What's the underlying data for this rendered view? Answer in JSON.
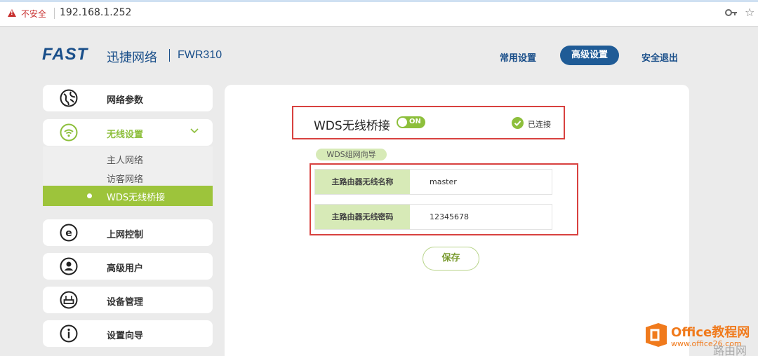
{
  "browser": {
    "security_label": "不安全",
    "url": "192.168.1.252"
  },
  "header": {
    "logo": "FAST",
    "brand": "迅捷网络",
    "model": "FWR310",
    "nav": {
      "common": "常用设置",
      "advanced": "高级设置",
      "logout": "安全退出"
    }
  },
  "sidebar": {
    "items": [
      {
        "label": "网络参数",
        "icon": "globe-icon"
      },
      {
        "label": "无线设置",
        "icon": "wifi-icon"
      },
      {
        "label": "上网控制",
        "icon": "internet-icon"
      },
      {
        "label": "高级用户",
        "icon": "user-icon"
      },
      {
        "label": "设备管理",
        "icon": "router-icon"
      },
      {
        "label": "设置向导",
        "icon": "info-icon"
      }
    ],
    "wireless_sub": {
      "host": "主人网络",
      "guest": "访客网络",
      "wds": "WDS无线桥接"
    }
  },
  "main": {
    "wds_title": "WDS无线桥接",
    "toggle_label": "ON",
    "toggle_on": true,
    "status": "已连接",
    "guide_tag": "WDS组网向导",
    "fields": [
      {
        "label": "主路由器无线名称",
        "value": "master"
      },
      {
        "label": "主路由器无线密码",
        "value": "12345678"
      }
    ],
    "save_label": "保存"
  },
  "watermark": {
    "title": "Office教程网",
    "url": "www.office26.com",
    "site": "路由网"
  },
  "colors": {
    "brand_blue": "#1f5b96",
    "accent_green": "#8dbf3c",
    "highlight_red": "#d8413f"
  }
}
